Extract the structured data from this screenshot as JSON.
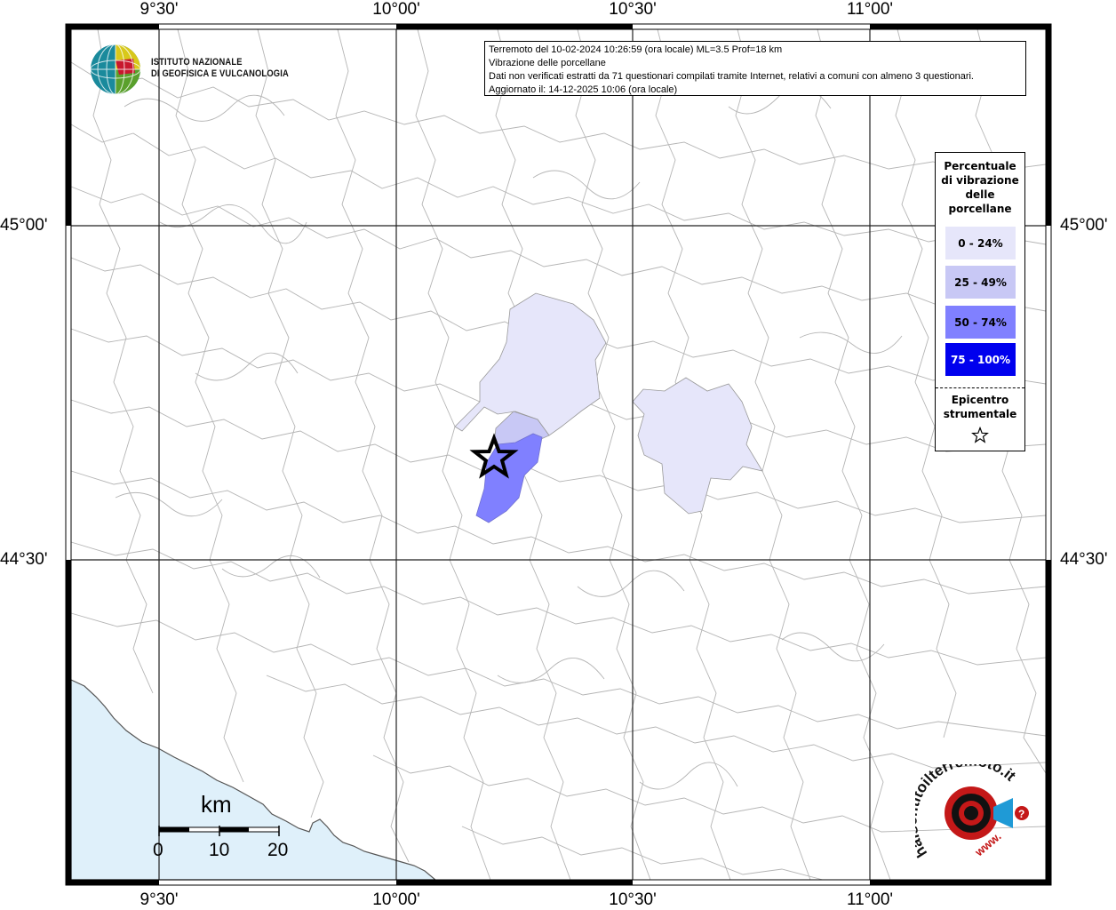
{
  "map": {
    "longitude_labels": [
      "9°30'",
      "10°00'",
      "10°30'",
      "11°00'"
    ],
    "latitude_labels": [
      "45°00'",
      "44°30'"
    ],
    "colors": {
      "background": "#ffffff",
      "sea": "#dff0fa",
      "boundaries": "#b5b5b5",
      "frame": "#000000",
      "class_0_24": "#e6e6fa",
      "class_25_49": "#c8c8f5",
      "class_50_74": "#8080ff",
      "class_75_100": "#0000ee"
    }
  },
  "info": {
    "line1": "Terremoto del 10-02-2024 10:26:59 (ora locale) ML=3.5 Prof=18 km",
    "line2": "Vibrazione delle porcellane",
    "line3": "Dati non verificati estratti da 71 questionari compilati tramite Internet, relativi a comuni con almeno 3 questionari.",
    "line4": "Aggiornato il: 14-12-2025 10:06 (ora locale)"
  },
  "legend": {
    "title_lines": [
      "Percentuale",
      "di vibrazione",
      "delle",
      "porcellane"
    ],
    "classes": [
      {
        "label": "0 - 24%",
        "color": "#e6e6fa",
        "text_color": "#000000"
      },
      {
        "label": "25 - 49%",
        "color": "#c8c8f5",
        "text_color": "#000000"
      },
      {
        "label": "50 - 74%",
        "color": "#8080ff",
        "text_color": "#000000"
      },
      {
        "label": "75 - 100%",
        "color": "#0000ee",
        "text_color": "#ffffff"
      }
    ],
    "epicenter_lines": [
      "Epicentro",
      "strumentale"
    ],
    "epicenter_icon": "star-icon"
  },
  "scale": {
    "unit": "km",
    "ticks": [
      "0",
      "10",
      "20"
    ]
  },
  "logos": {
    "ingv_lines": [
      "ISTITUTO NAZIONALE",
      "DI GEOFISICA E VULCANOLOGIA"
    ],
    "hst_text": "haisentitoilterremoto.it",
    "hst_url": "www.",
    "hst_question": "?"
  }
}
